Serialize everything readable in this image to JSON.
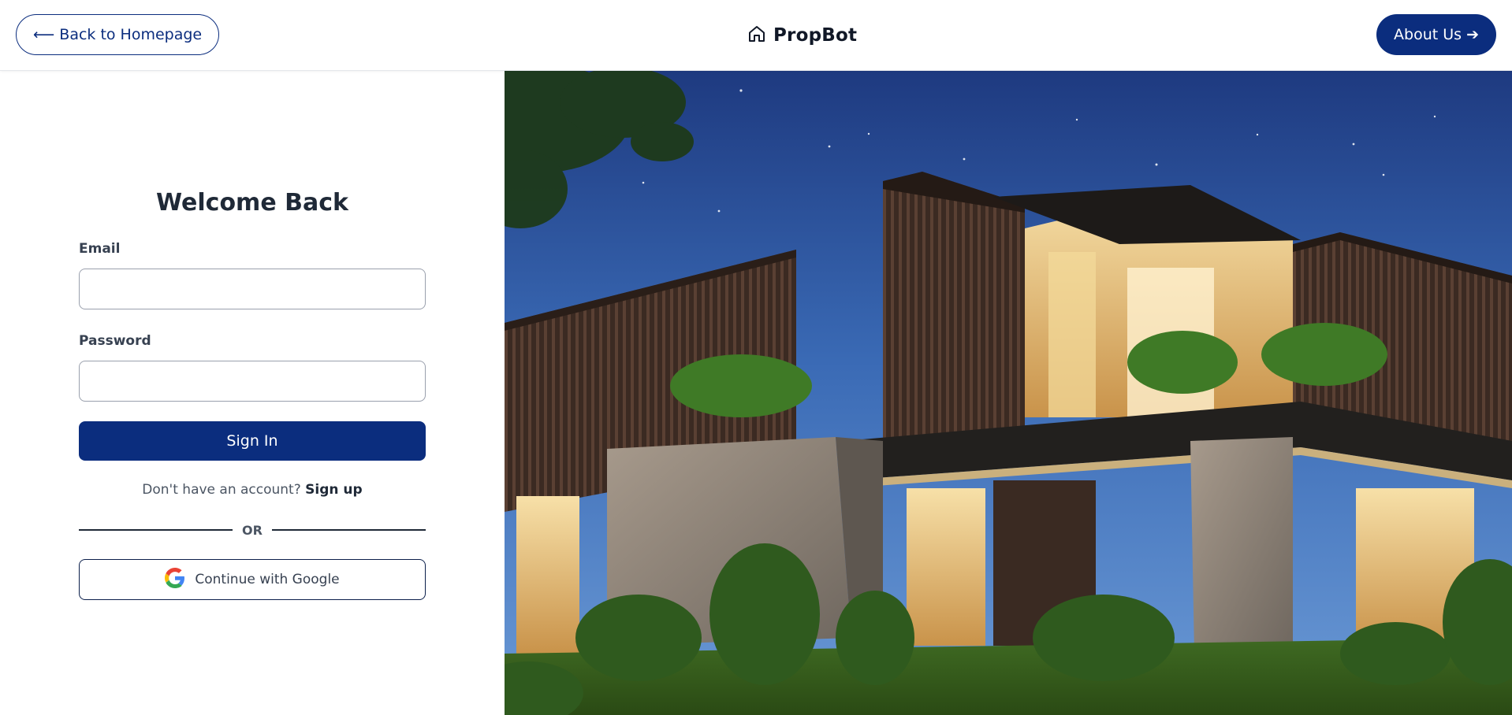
{
  "header": {
    "back_label": "⟵ Back to Homepage",
    "brand_name": "PropBot",
    "about_label": "About Us ➔"
  },
  "login": {
    "title": "Welcome Back",
    "email_label": "Email",
    "email_value": "",
    "password_label": "Password",
    "password_value": "",
    "signin_label": "Sign In",
    "signup_prompt": "Don't have an account?",
    "signup_link": "Sign up",
    "or_text": "OR",
    "google_label": "Continue with Google"
  },
  "colors": {
    "primary": "#0b2d7e",
    "text": "#1f2937"
  },
  "icons": {
    "brand": "home-icon",
    "google": "google-icon"
  }
}
